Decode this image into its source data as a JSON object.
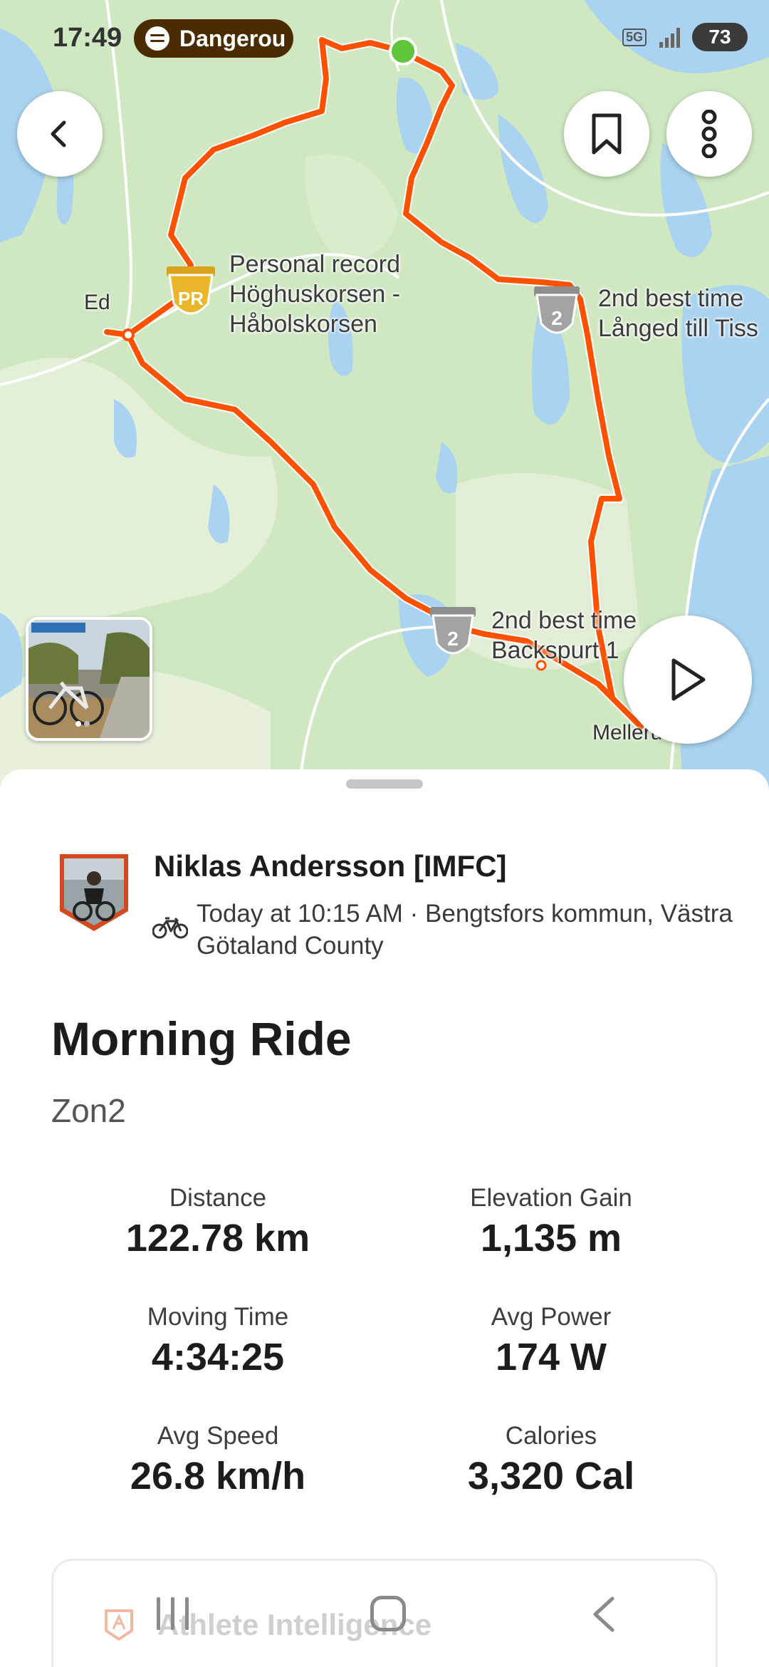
{
  "status_bar": {
    "time": "17:49",
    "media_pill": "Dangerou",
    "network": "5G",
    "battery": "73",
    "media_icon": "spotify-icon"
  },
  "map": {
    "town_ed": "Ed",
    "town_mellerud": "Mellerud",
    "segment_pr": {
      "badge": "PR",
      "line1": "Personal record",
      "line2": "Höghuskorsen -",
      "line3": "Håbolskorsen"
    },
    "segment_2a": {
      "badge": "2",
      "line1": "2nd best time",
      "line2": "Långed till Tiss"
    },
    "segment_2b": {
      "badge": "2",
      "line1": "2nd best time",
      "line2": "Backspurt 1"
    },
    "colors": {
      "route": "#fc5200",
      "start_dot": "#5fc53a",
      "water": "#a9d3f0",
      "land": "#cfe8c2"
    }
  },
  "activity": {
    "athlete_name": "Niklas Andersson [IMFC]",
    "meta": "Today at 10:15 AM · Bengtsfors kommun, Västra Götaland County",
    "sport_icon": "bike-icon",
    "title": "Morning Ride",
    "description": "Zon2",
    "stats": [
      {
        "label": "Distance",
        "value": "122.78 km"
      },
      {
        "label": "Elevation Gain",
        "value": "1,135 m"
      },
      {
        "label": "Moving Time",
        "value": "4:34:25"
      },
      {
        "label": "Avg Power",
        "value": "174 W"
      },
      {
        "label": "Avg Speed",
        "value": "26.8 km/h"
      },
      {
        "label": "Calories",
        "value": "3,320 Cal"
      }
    ]
  },
  "athlete_intelligence": {
    "label": "Athlete Intelligence"
  }
}
